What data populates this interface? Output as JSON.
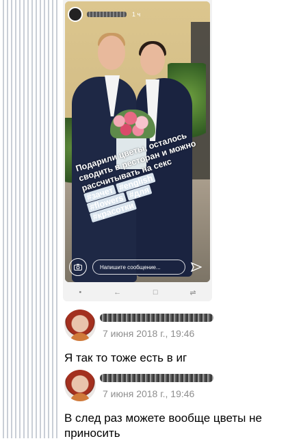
{
  "story": {
    "time": "1 ч",
    "caption_lines": [
      "Подарили цветы, осталось",
      "сводить в ресторан и можно",
      "рассчитывать на секс"
    ],
    "hashtags": [
      [
        "#зачет",
        "#english"
      ],
      [
        "#flowers",
        "#для"
      ],
      [
        "#красотки"
      ]
    ],
    "message_placeholder": "Напишите сообщение...",
    "icons": {
      "camera": "camera-icon",
      "send": "send-icon",
      "story_avatar": "avatar"
    }
  },
  "navbar": {
    "items": [
      "•",
      "←",
      "□",
      "⇌"
    ]
  },
  "comments": [
    {
      "date": "7 июня 2018 г., 19:46",
      "text": "Я так то тоже есть в иг"
    },
    {
      "date": "7 июня 2018 г., 19:46",
      "text": "В след раз можете вообще цветы не приносить"
    }
  ],
  "colors": {
    "background": "#ffffff",
    "stripe": "#c9ced6",
    "date_gray": "#8e8e8e",
    "text": "#000000"
  }
}
